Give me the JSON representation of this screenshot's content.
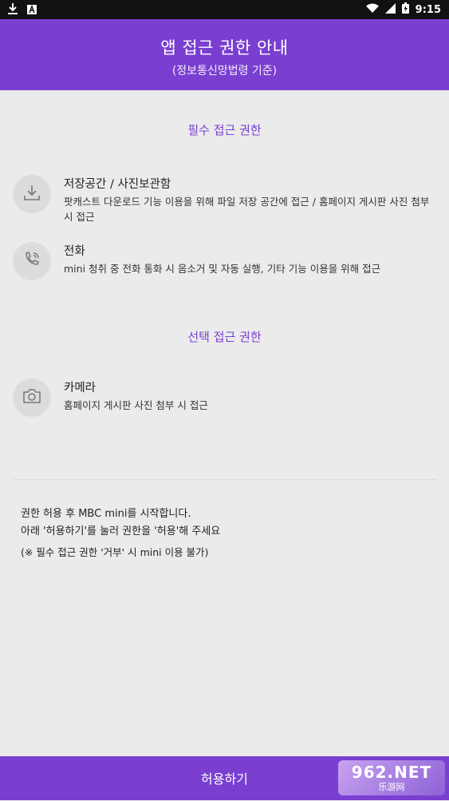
{
  "status_bar": {
    "time": "9:15",
    "icons": [
      "download-icon",
      "font-a-icon",
      "wifi-icon",
      "signal-icon",
      "battery-icon"
    ]
  },
  "header": {
    "title": "앱 접근 권한 안내",
    "subtitle": "(정보통신망법령 기준)"
  },
  "required_section": {
    "title": "필수 접근 권한",
    "items": [
      {
        "name": "저장공간 / 사진보관함",
        "desc": "팟캐스트 다운로드 기능 이용을 위해 파일 저장 공간에 접근 / 홈페이지 게시판 사진 첨부 시 접근",
        "icon": "download-icon"
      },
      {
        "name": "전화",
        "desc": "mini 청취 중 전화 통화 시 음소거 및 자동 실행, 기타 기능 이용을 위해 접근",
        "icon": "phone-call-icon"
      }
    ]
  },
  "optional_section": {
    "title": "선택 접근 권한",
    "items": [
      {
        "name": "카메라",
        "desc": "홈페이지 게시판 사진 첨부 시 접근",
        "icon": "camera-icon"
      }
    ]
  },
  "notice": {
    "line1": "권한 허용 후 MBC mini를 시작합니다.",
    "line2": "아래 '허용하기'를 눌러 권한을 '허용'해 주세요",
    "note": "(※ 필수 접근 권한 '거부' 시 mini 이용 불가)"
  },
  "allow_button": {
    "label": "허용하기"
  },
  "watermark": {
    "line1": "962.NET",
    "line2": "乐游网"
  },
  "colors": {
    "accent": "#7a3fd1",
    "background": "#ebebeb"
  }
}
